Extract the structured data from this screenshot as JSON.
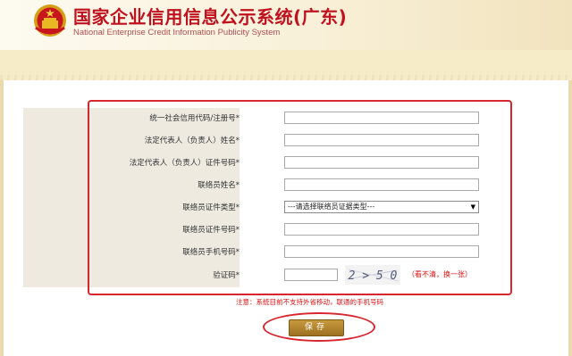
{
  "header": {
    "title_cn": "国家企业信用信息公示系统(广东)",
    "title_en": "National Enterprise Credit Information Publicity System",
    "emblem_icon": "national-emblem-icon"
  },
  "form": {
    "rows": [
      {
        "label": "统一社会信用代码/注册号*",
        "type": "text",
        "value": ""
      },
      {
        "label": "法定代表人（负责人）姓名*",
        "type": "text",
        "value": ""
      },
      {
        "label": "法定代表人（负责人）证件号码*",
        "type": "text",
        "value": ""
      },
      {
        "label": "联络员姓名*",
        "type": "text",
        "value": ""
      },
      {
        "label": "联络员证件类型*",
        "type": "select",
        "value": "---请选择联络员证据类型---"
      },
      {
        "label": "联络员证件号码*",
        "type": "text",
        "value": ""
      },
      {
        "label": "联络员手机号码*",
        "type": "text",
        "value": ""
      }
    ],
    "captcha": {
      "label": "验证码*",
      "image_text": "2 > 5 0",
      "refresh_text": "（看不清，换一张）"
    },
    "notice": "注意：系统目前不支持外省移动，联通的手机号码",
    "save_label": "保存"
  },
  "colors": {
    "title_red": "#c0121e",
    "highlight_red": "#d8262f",
    "button_gold": "#b58630",
    "label_bg": "#eeeae0",
    "band_bg": "#f7ecc8"
  }
}
